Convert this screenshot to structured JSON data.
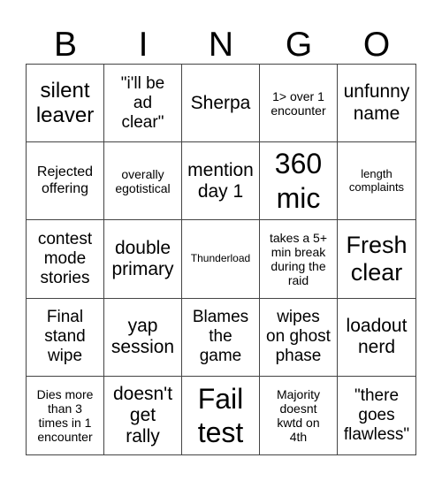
{
  "header": [
    "B",
    "I",
    "N",
    "G",
    "O"
  ],
  "cells": [
    "silent\nleaver",
    "\"i'll be\nad\nclear\"",
    "Sherpa",
    "1> over 1\nencounter",
    "unfunny\nname",
    "Rejected\noffering",
    "overally\negotistical",
    "mention\nday 1",
    "360\nmic",
    "length\ncomplaints",
    "contest\nmode\nstories",
    "double\nprimary",
    "Thunderload",
    "takes a 5+\nmin break\nduring the\nraid",
    "Fresh\nclear",
    "Final\nstand\nwipe",
    "yap\nsession",
    "Blames\nthe\ngame",
    "wipes\non ghost\nphase",
    "loadout\nnerd",
    "Dies more\nthan 3\ntimes in 1\nencounter",
    "doesn't\nget\nrally",
    "Fail\ntest",
    "Majority\ndoesnt\nkwtd on\n4th",
    "\"there\ngoes\nflawless\""
  ]
}
